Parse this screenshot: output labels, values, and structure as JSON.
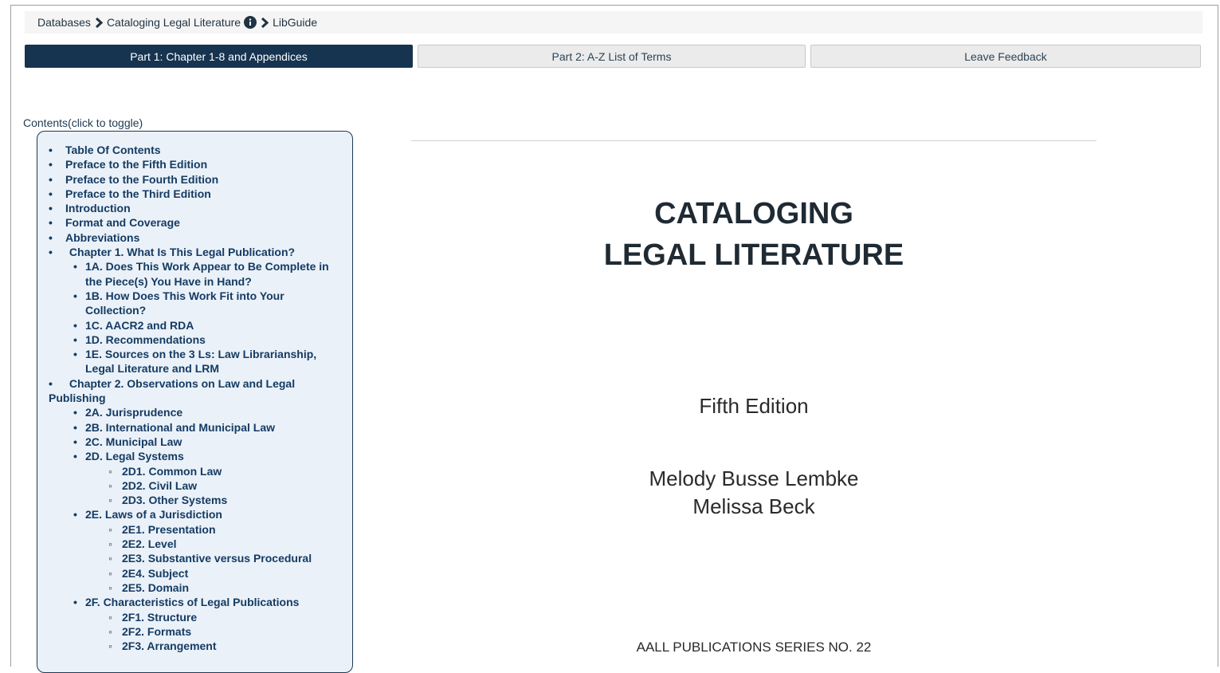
{
  "breadcrumb": {
    "items": [
      "Databases",
      "Cataloging Legal Literature",
      "LibGuide"
    ]
  },
  "tabs": [
    {
      "label": "Part 1: Chapter 1-8 and Appendices",
      "active": true
    },
    {
      "label": "Part 2: A-Z List of Terms",
      "active": false
    },
    {
      "label": "Leave Feedback",
      "active": false
    }
  ],
  "toc": {
    "toggle_label": "Contents(click to toggle)",
    "items": [
      {
        "level": 1,
        "label": "Table Of Contents"
      },
      {
        "level": 1,
        "label": "Preface to the Fifth Edition"
      },
      {
        "level": 1,
        "label": "Preface to the Fourth Edition"
      },
      {
        "level": 1,
        "label": "Preface to the Third Edition"
      },
      {
        "level": 1,
        "label": "Introduction"
      },
      {
        "level": 1,
        "label": "Format and Coverage"
      },
      {
        "level": 1,
        "label": "Abbreviations"
      },
      {
        "level": 1,
        "label": "Chapter 1. What Is This Legal Publication?"
      },
      {
        "level": 2,
        "label": "1A. Does This Work Appear to Be Complete in the Piece(s) You Have in Hand?"
      },
      {
        "level": 2,
        "label": "1B. How Does This Work Fit into Your Collection?"
      },
      {
        "level": 2,
        "label": "1C. AACR2 and RDA"
      },
      {
        "level": 2,
        "label": "1D. Recommendations"
      },
      {
        "level": 2,
        "label": "1E. Sources on the 3 Ls: Law Librarianship, Legal Literature and LRM"
      },
      {
        "level": 1,
        "label": "Chapter 2. Observations on Law and Legal Publishing"
      },
      {
        "level": 2,
        "label": "2A. Jurisprudence"
      },
      {
        "level": 2,
        "label": "2B. International and Municipal Law"
      },
      {
        "level": 2,
        "label": "2C. Municipal Law"
      },
      {
        "level": 2,
        "label": "2D. Legal Systems"
      },
      {
        "level": 3,
        "label": "2D1. Common Law"
      },
      {
        "level": 3,
        "label": "2D2. Civil Law"
      },
      {
        "level": 3,
        "label": "2D3. Other Systems"
      },
      {
        "level": 2,
        "label": "2E. Laws of a Jurisdiction"
      },
      {
        "level": 3,
        "label": "2E1. Presentation"
      },
      {
        "level": 3,
        "label": "2E2. Level"
      },
      {
        "level": 3,
        "label": "2E3. Substantive versus Procedural"
      },
      {
        "level": 3,
        "label": "2E4. Subject"
      },
      {
        "level": 3,
        "label": "2E5. Domain"
      },
      {
        "level": 2,
        "label": "2F. Characteristics of Legal Publications"
      },
      {
        "level": 3,
        "label": "2F1. Structure"
      },
      {
        "level": 3,
        "label": "2F2. Formats"
      },
      {
        "level": 3,
        "label": "2F3. Arrangement"
      }
    ]
  },
  "document": {
    "title_line1": "CATALOGING",
    "title_line2": "LEGAL LITERATURE",
    "edition": "Fifth Edition",
    "author1": "Melody Busse Lembke",
    "author2": "Melissa Beck",
    "series": "AALL PUBLICATIONS SERIES NO. 22"
  },
  "colors": {
    "active_tab": "#16334f",
    "toc_background": "#eaf1f8",
    "toc_link": "#153b63"
  }
}
